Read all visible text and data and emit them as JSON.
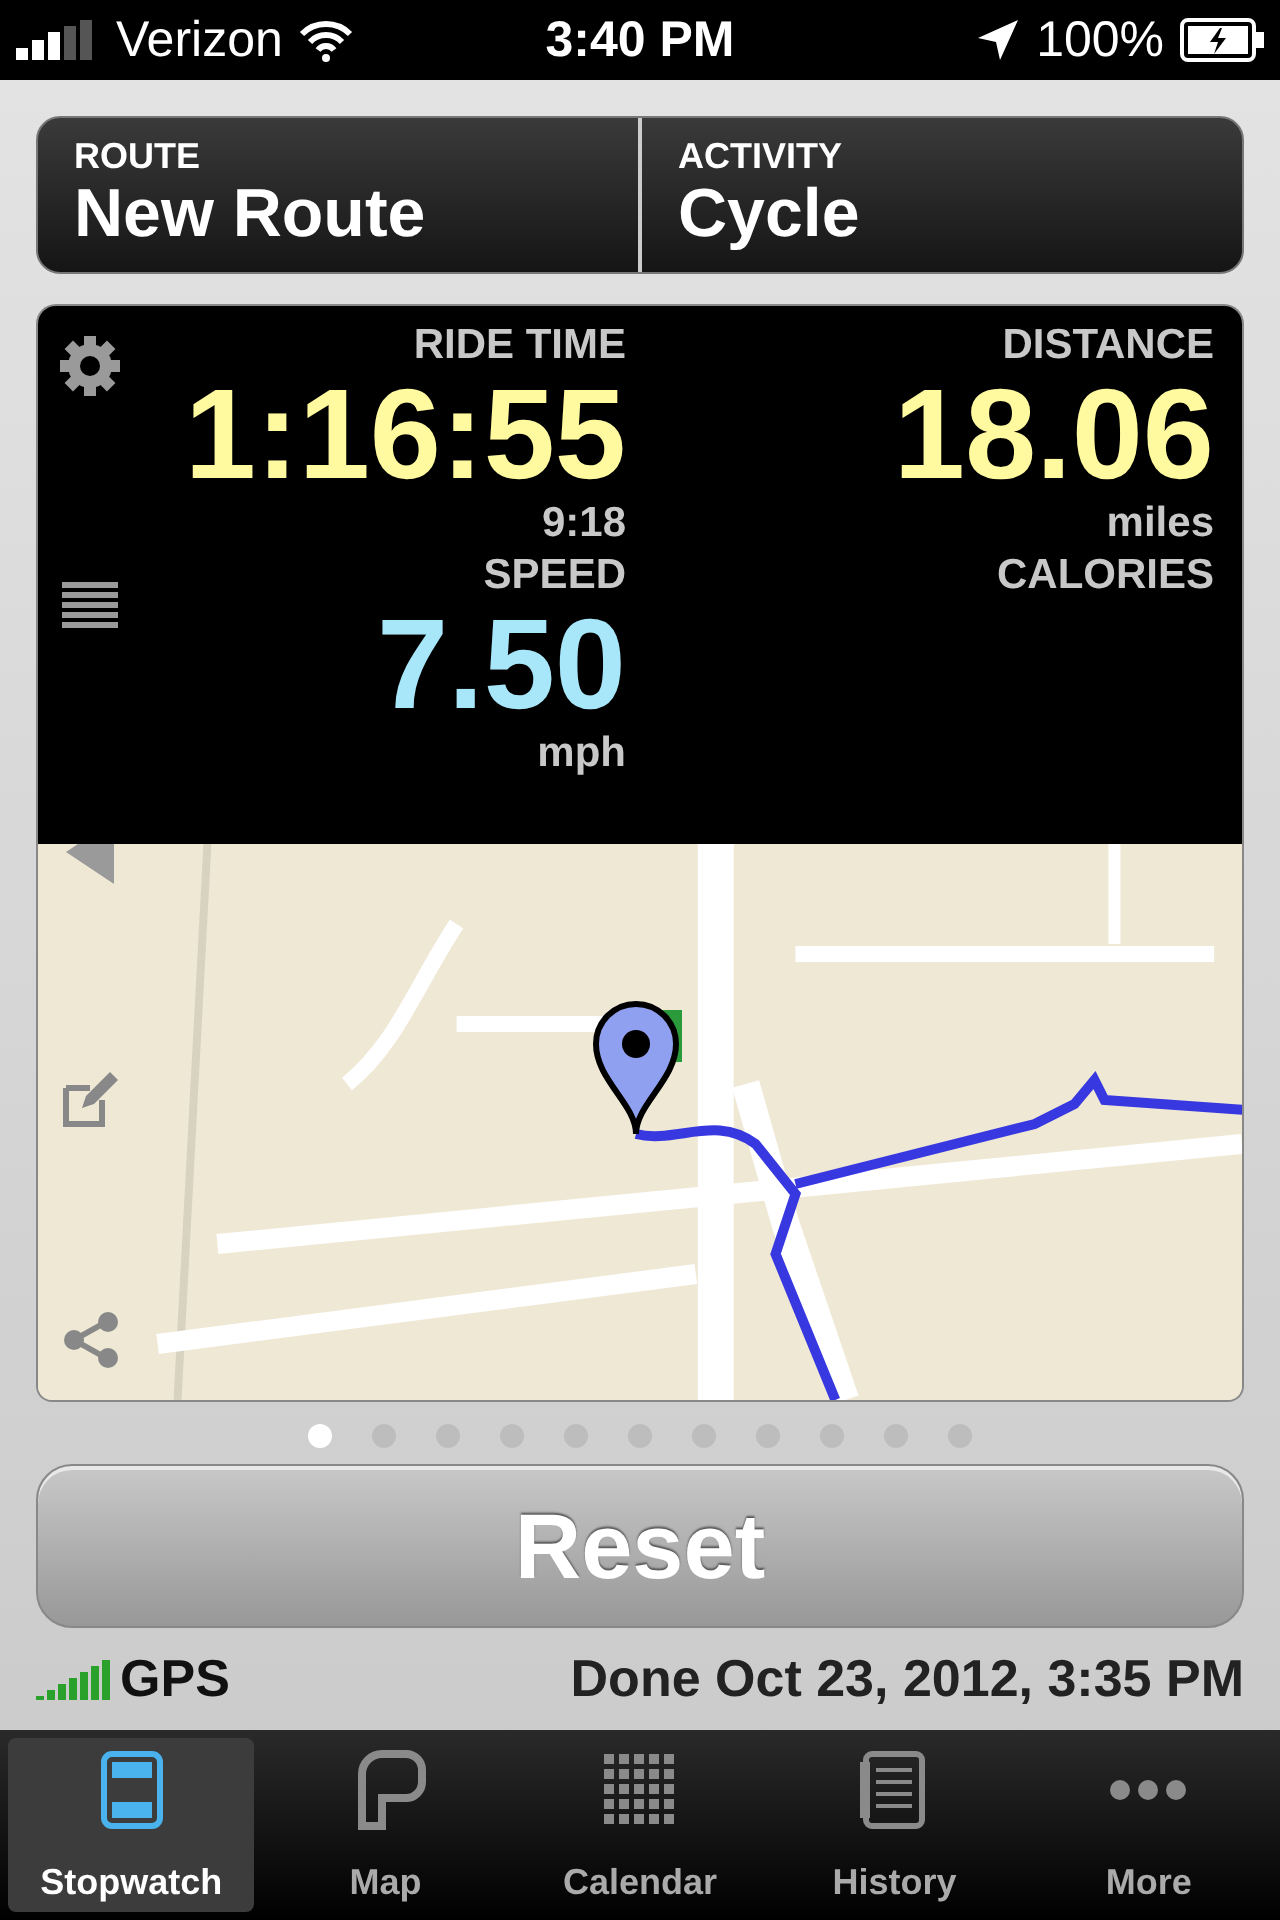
{
  "status_bar": {
    "carrier": "Verizon",
    "time": "3:40 PM",
    "battery": "100%"
  },
  "header": [
    {
      "label": "ROUTE",
      "value": "New Route"
    },
    {
      "label": "ACTIVITY",
      "value": "Cycle"
    }
  ],
  "stats": [
    {
      "label": "RIDE TIME",
      "value": "1:16:55",
      "sub": "9:18",
      "color": "#fffaa0"
    },
    {
      "label": "DISTANCE",
      "value": "18.06",
      "sub": "miles",
      "color": "#fffaa0"
    },
    {
      "label": "SPEED",
      "value": "7.50",
      "sub": "mph",
      "color": "#a8e6fa"
    },
    {
      "label": "CALORIES"
    }
  ],
  "pages": [
    {
      "selected": true
    },
    {
      "selected": false
    },
    {
      "selected": false
    },
    {
      "selected": false
    },
    {
      "selected": false
    },
    {
      "selected": false
    },
    {
      "selected": false
    },
    {
      "selected": false
    },
    {
      "selected": false
    },
    {
      "selected": false
    },
    {
      "selected": false
    }
  ],
  "reset_button": "Reset",
  "gps": {
    "label": "GPS"
  },
  "done": "Done Oct 23, 2012, 3:35 PM",
  "tabs": [
    {
      "label": "Stopwatch",
      "kind": "stopwatch",
      "selected": true
    },
    {
      "label": "Map",
      "kind": "map",
      "selected": false
    },
    {
      "label": "Calendar",
      "kind": "calendar",
      "selected": false
    },
    {
      "label": "History",
      "kind": "history",
      "selected": false
    },
    {
      "label": "More",
      "kind": "more",
      "selected": false
    }
  ]
}
